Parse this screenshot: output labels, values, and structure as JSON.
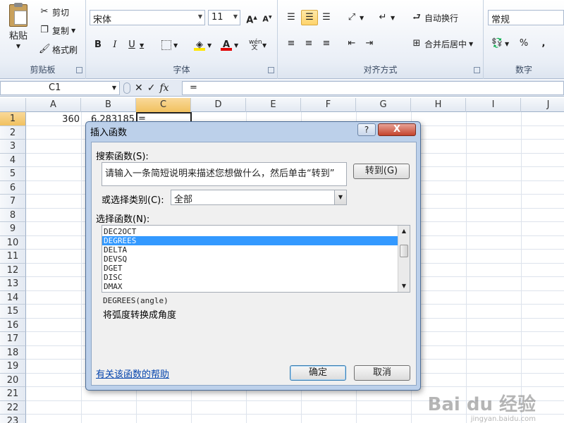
{
  "ribbon": {
    "clipboard": {
      "paste": "粘贴",
      "cut": "剪切",
      "copy": "复制",
      "format_painter": "格式刷",
      "label": "剪贴板"
    },
    "font": {
      "name": "宋体",
      "size": "11",
      "label": "字体",
      "bold": "B",
      "italic": "I",
      "underline": "U",
      "phonetic": "wén"
    },
    "alignment": {
      "wrap_text": "自动换行",
      "merge_center": "合并后居中",
      "label": "对齐方式"
    },
    "number": {
      "format": "常规",
      "percent": "%",
      "comma": ",",
      "label": "数字"
    }
  },
  "formula_bar": {
    "name_box": "C1",
    "fx": "fx",
    "value": "="
  },
  "grid": {
    "columns": [
      "A",
      "B",
      "C",
      "D",
      "E",
      "F",
      "G",
      "H",
      "I",
      "J"
    ],
    "rows": [
      "1",
      "2",
      "3",
      "4",
      "5",
      "6",
      "7",
      "8",
      "9",
      "10",
      "11",
      "12",
      "13",
      "14",
      "15",
      "16",
      "17",
      "18",
      "19",
      "20",
      "21",
      "22",
      "23"
    ],
    "cells": {
      "A1": "360",
      "B1": "6.283185",
      "C1": "="
    }
  },
  "dialog": {
    "title": "插入函数",
    "help": "?",
    "close": "X",
    "search_label": "搜索函数(S):",
    "search_value": "请输入一条简短说明来描述您想做什么，然后单击“转到”",
    "go_button": "转到(G)",
    "category_label": "或选择类别(C):",
    "category_value": "全部",
    "select_label": "选择函数(N):",
    "functions": [
      "DEC2OCT",
      "DEGREES",
      "DELTA",
      "DEVSQ",
      "DGET",
      "DISC",
      "DMAX"
    ],
    "selected_function": "DEGREES",
    "syntax": "DEGREES(angle)",
    "description": "将弧度转换成角度",
    "help_link": "有关该函数的帮助",
    "ok": "确定",
    "cancel": "取消"
  },
  "watermark": {
    "text": "Bai du 经验",
    "sub": "jingyan.baidu.com"
  }
}
